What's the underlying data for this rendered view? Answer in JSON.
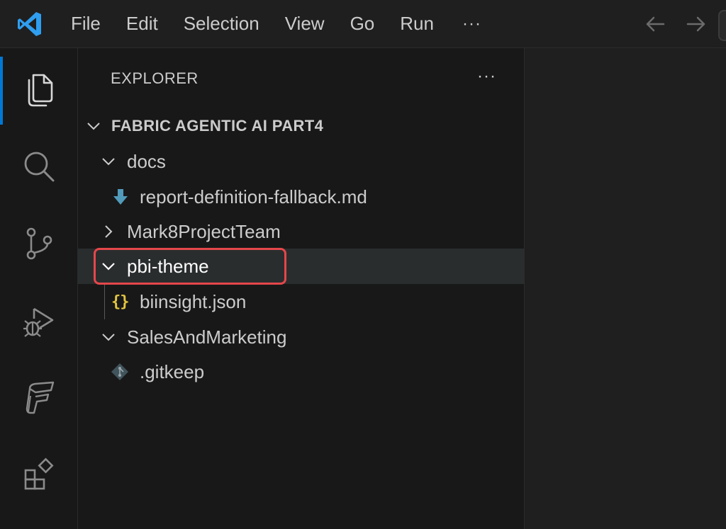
{
  "menu": {
    "items": [
      "File",
      "Edit",
      "Selection",
      "View",
      "Go",
      "Run"
    ],
    "more": "···"
  },
  "activity_bar": {
    "items": [
      "files-icon",
      "search-icon",
      "source-control-icon",
      "run-debug-icon",
      "fabric-icon",
      "extensions-icon"
    ],
    "active": "files-icon",
    "accent": "#0078d4"
  },
  "explorer": {
    "header": "EXPLORER",
    "more": "···",
    "root": "FABRIC AGENTIC AI PART4",
    "tree": [
      {
        "label": "docs",
        "type": "folder",
        "expanded": true
      },
      {
        "label": "report-definition-fallback.md",
        "type": "file",
        "icon": "markdown-download-icon"
      },
      {
        "label": "Mark8ProjectTeam",
        "type": "folder",
        "expanded": false
      },
      {
        "label": "pbi-theme",
        "type": "folder",
        "expanded": true,
        "selected": true
      },
      {
        "label": "biinsight.json",
        "type": "file",
        "icon": "json-braces-icon",
        "icon_text": "{}"
      },
      {
        "label": "SalesAndMarketing",
        "type": "folder",
        "expanded": true
      },
      {
        "label": ".gitkeep",
        "type": "file",
        "icon": "git-icon"
      }
    ]
  },
  "colors": {
    "highlight_box": "#e5474b",
    "json_icon": "#e2c541",
    "md_icon": "#519aba",
    "git_icon": "#41535b"
  }
}
